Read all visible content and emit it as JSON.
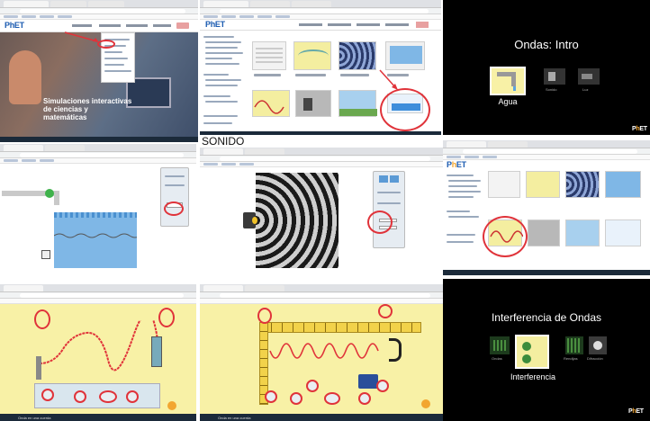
{
  "panels": {
    "home": {
      "logo": "PhET",
      "hero_title": "Simulaciones interactivas de ciencias y matemáticas"
    },
    "browse": {
      "logo": "PhET"
    },
    "waves_intro": {
      "title": "Ondas: Intro",
      "screens": [
        {
          "label": "Agua"
        },
        {
          "label": "Sonido"
        },
        {
          "label": "Luz"
        }
      ]
    },
    "sound": {
      "caption": "SONIDO"
    },
    "interference": {
      "title": "Interferencia de Ondas",
      "screens": [
        {
          "label": "Ondas"
        },
        {
          "label": "Interferencia"
        },
        {
          "label": "Rendijas"
        },
        {
          "label": "Difracción"
        }
      ]
    },
    "string_left": {
      "taskbar_text": "Onda en una cuerda"
    },
    "string_right": {
      "taskbar_text": "Onda en una cuerda"
    }
  },
  "colors": {
    "annotation": "#e0333a",
    "phet_blue": "#1b5bb0",
    "phet_orange": "#f2a630",
    "sim_yellow": "#f8f1a6",
    "water_blue": "#7fb7e6",
    "dark_bg": "#000000"
  }
}
